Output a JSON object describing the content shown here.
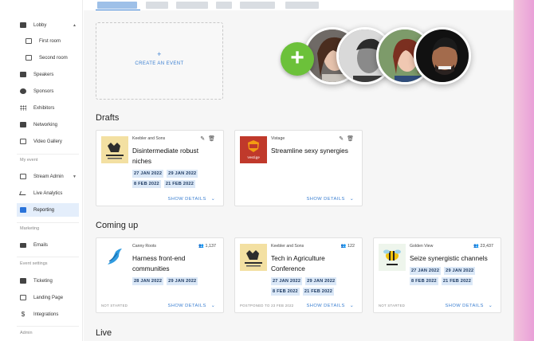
{
  "sidebar": {
    "items": [
      {
        "label": "Lobby",
        "icon": "grid-icon",
        "child": false,
        "chevron": "▲"
      },
      {
        "label": "First room",
        "icon": "room-icon",
        "child": true
      },
      {
        "label": "Second room",
        "icon": "room-icon",
        "child": true
      },
      {
        "label": "Speakers",
        "icon": "person-icon",
        "child": false
      },
      {
        "label": "Sponsors",
        "icon": "gear-icon",
        "child": false
      },
      {
        "label": "Exhibitors",
        "icon": "dots-grid-icon",
        "child": false
      },
      {
        "label": "Networking",
        "icon": "contacts-icon",
        "child": false
      },
      {
        "label": "Video Gallery",
        "icon": "video-icon",
        "child": false
      }
    ],
    "my_event_header": "My event",
    "my_event_items": [
      {
        "label": "Stream Admin",
        "icon": "stream-icon",
        "chevron": "▼"
      },
      {
        "label": "Live Analytics",
        "icon": "trend-icon"
      },
      {
        "label": "Reporting",
        "icon": "chart-icon",
        "active": true
      }
    ],
    "marketing_header": "Marketing",
    "marketing_items": [
      {
        "label": "Emails",
        "icon": "mail-icon"
      }
    ],
    "event_settings_header": "Event settings",
    "event_settings_items": [
      {
        "label": "Ticketing",
        "icon": "ticket-icon"
      },
      {
        "label": "Landing Page",
        "icon": "page-icon"
      },
      {
        "label": "Integrations",
        "icon": "dollar-icon"
      }
    ],
    "admin_header": "Admin"
  },
  "create_event": {
    "plus": "+",
    "label": "CREATE AN EVENT"
  },
  "add_person": "+",
  "sections": {
    "drafts": "Drafts",
    "coming_up": "Coming up",
    "live": "Live"
  },
  "drafts": [
    {
      "company": "Keebler and Sons",
      "title_lines": [
        "Disintermediate robust",
        "niches"
      ],
      "dates": [
        "27 JAN 2022",
        "29 JAN 2022",
        "8 FEB 2022",
        "21 FEB 2022"
      ],
      "show_details": "SHOW DETAILS",
      "chevron": "⌄",
      "edit_icon": "✎",
      "delete_icon": "🗑",
      "logo": "moose-logo"
    },
    {
      "company": "Vistage",
      "title_lines": [
        "Streamline sexy synergies"
      ],
      "dates": [],
      "show_details": "SHOW DETAILS",
      "chevron": "⌄",
      "edit_icon": "✎",
      "delete_icon": "🗑",
      "logo": "vestige-logo",
      "logo_text": "vestige"
    }
  ],
  "coming_up": [
    {
      "company": "Canny Roots",
      "count": "1,137",
      "title_lines": [
        "Harness front-end",
        "communities"
      ],
      "dates": [
        "28 JAN 2022",
        "29 JAN 2022"
      ],
      "status": "NOT STARTED",
      "show_details": "SHOW DETAILS",
      "chevron": "⌄",
      "logo": "bird-logo"
    },
    {
      "company": "Keebler and Sons",
      "count": "122",
      "title_lines": [
        "Tech in Agriculture",
        "Conference"
      ],
      "dates": [
        "27 JAN 2022",
        "29 JAN 2022",
        "8 FEB 2022",
        "21 FEB 2022"
      ],
      "status": "POSTPONED TO 23 FEB 2022",
      "show_details": "SHOW DETAILS",
      "chevron": "⌄",
      "logo": "moose-logo"
    },
    {
      "company": "Golden View",
      "count": "23,437",
      "title_lines": [
        "Seize synergistic channels"
      ],
      "dates": [
        "27 JAN 2022",
        "29 JAN 2022",
        "8 FEB 2022",
        "21 FEB 2022"
      ],
      "status": "NOT STARTED",
      "show_details": "SHOW DETAILS",
      "chevron": "⌄",
      "logo": "bee-logo"
    }
  ],
  "people_icon": "👥"
}
